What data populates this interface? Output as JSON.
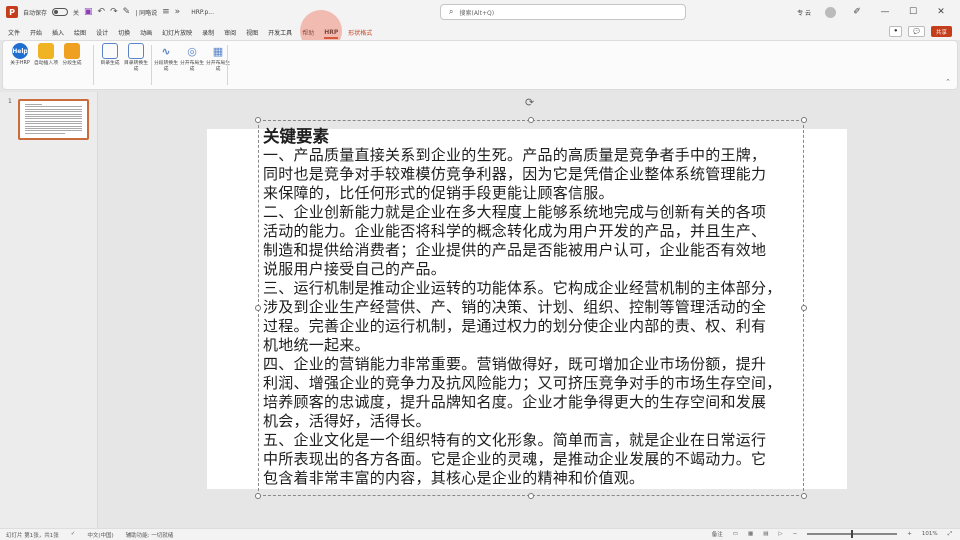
{
  "titlebar": {
    "autosave_label": "自动保存",
    "toggle_state": "关",
    "quick_access_mode": "| 同略说",
    "file_name": "HRP.p...",
    "search_placeholder": "搜索(Alt+Q)",
    "user_name": "专 云"
  },
  "tabs": [
    "文件",
    "开始",
    "插入",
    "绘图",
    "设计",
    "切换",
    "动画",
    "幻灯片放映",
    "录制",
    "审阅",
    "视图",
    "开发工具",
    "帮助",
    "HRP",
    "形状格式"
  ],
  "active_tab": "HRP",
  "tabs_right": {
    "comment_btn": "批注",
    "share_btn": "共享"
  },
  "ribbon": {
    "buttons": [
      {
        "label": "关于HRP",
        "icon": "help-badge-icon",
        "color": "#1f6fd1",
        "glyph": "Help"
      },
      {
        "label": "自动插入项",
        "icon": "cup-icon",
        "color": "#f0b323",
        "glyph": ""
      },
      {
        "label": "分段生成",
        "icon": "layers-icon",
        "color": "#f0a020",
        "glyph": ""
      },
      {
        "label": "目录生成",
        "icon": "toc-icon",
        "color": "#5a84c9",
        "glyph": ""
      },
      {
        "label": "目录转换生成",
        "icon": "convert-toc-icon",
        "color": "#5a84c9",
        "glyph": ""
      },
      {
        "label": "分段转换生成",
        "icon": "wave-icon",
        "color": "#5a84c9",
        "glyph": ""
      },
      {
        "label": "分开布局生成",
        "icon": "cycle-icon",
        "color": "#5a84c9",
        "glyph": ""
      },
      {
        "label": "分开布局生成",
        "icon": "grid-icon",
        "color": "#5a84c9",
        "glyph": ""
      }
    ]
  },
  "slides": {
    "current_number": "1"
  },
  "slide": {
    "heading": "关键要素",
    "lines": [
      "一、产品质量直接关系到企业的生死。产品的高质量是竞争者手中的王牌，",
      "同时也是竞争对手较难模仿竞争利器，因为它是凭借企业整体系统管理能力",
      "来保障的，比任何形式的促销手段更能让顾客信服。",
      "二、企业创新能力就是企业在多大程度上能够系统地完成与创新有关的各项",
      "活动的能力。企业能否将科学的概念转化成为用户开发的产品，并且生产、",
      "制造和提供给消费者；企业提供的产品是否能被用户认可，企业能否有效地",
      "说服用户接受自己的产品。",
      "三、运行机制是推动企业运转的功能体系。它构成企业经营机制的主体部分，",
      "涉及到企业生产经营供、产、销的决策、计划、组织、控制等管理活动的全",
      "过程。完善企业的运行机制，是通过权力的划分使企业内部的责、权、利有",
      "机地统一起来。",
      "四、企业的营销能力非常重要。营销做得好，既可增加企业市场份额，提升",
      "利润、增强企业的竞争力及抗风险能力；又可挤压竞争对手的市场生存空间，",
      "培养顾客的忠诚度，提升品牌知名度。企业才能争得更大的生存空间和发展",
      "机会，活得好，活得长。",
      "五、企业文化是一个组织特有的文化形象。简单而言，就是企业在日常运行",
      "中所表现出的各方各面。它是企业的灵魂，是推动企业发展的不竭动力。它",
      "包含着非常丰富的内容，其核心是企业的精神和价值观。"
    ]
  },
  "statusbar": {
    "slide_info": "幻灯片 第1张，共1张",
    "language": "中文(中国)",
    "accessibility": "辅助功能: 一切就绪",
    "notes": "备注",
    "zoom": "101%"
  },
  "colors": {
    "accent": "#c43e1c",
    "thumb_border": "#c96b3b"
  }
}
